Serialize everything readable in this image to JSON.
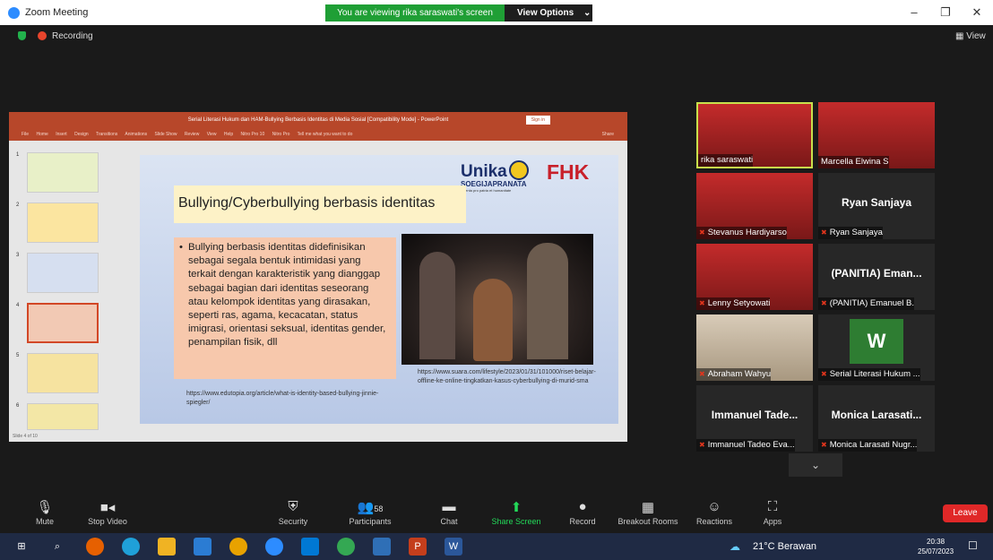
{
  "window": {
    "title": "Zoom Meeting",
    "viewing_banner": "You are viewing rika saraswati's screen",
    "view_options": "View Options"
  },
  "topbar": {
    "recording": "Recording",
    "view_label": "View"
  },
  "ppt": {
    "title": "Serial Literasi Hukum dan HAM-Bullying Berbasis Identitas di Media Sosial [Compatibility Mode] - PowerPoint",
    "signin": "Sign in",
    "menu": [
      "File",
      "Home",
      "Insert",
      "Design",
      "Transitions",
      "Animations",
      "Slide Show",
      "Review",
      "View",
      "Help",
      "Nitro Pro 10",
      "Nitro Pro",
      "Tell me what you want to do",
      "Share"
    ],
    "thumb_numbers": [
      "1",
      "2",
      "3",
      "4",
      "5",
      "6"
    ],
    "status": "Slide 4 of 10",
    "slide": {
      "logo_unika": "Unika",
      "logo_sub": "SOEGIJAPRANATA",
      "logo_tag": "Talenta pro patria et humanitate",
      "logo_fhk": "FHK",
      "heading": "Bullying/Cyberbullying berbasis identitas",
      "bullet": "•",
      "body": "Bullying berbasis identitas didefinisikan sebagai segala bentuk intimidasi yang terkait dengan karakteristik yang dianggap sebagai bagian dari identitas seseorang atau kelompok identitas yang dirasakan, seperti ras, agama, kecacatan, status imigrasi, orientasi seksual, identitas gender, penampilan fisik, dll",
      "url_photo": "https://www.suara.com/lifestyle/2023/01/31/101000/riset-belajar-offline-ke-online-tingkatkan-kasus-cyberbullying-di-murid-sma",
      "url_source": "https://www.edutopia.org/article/what-is-identity-based-bullying-jinnie-spiegler/"
    }
  },
  "participants": [
    {
      "name": "rika saraswati",
      "type": "video"
    },
    {
      "name": "Marcella Elwina S",
      "type": "video"
    },
    {
      "name": "Stevanus Hardiyarso",
      "type": "video"
    },
    {
      "name": "Ryan Sanjaya",
      "type": "name",
      "display": "Ryan Sanjaya"
    },
    {
      "name": "Lenny Setyowati",
      "type": "video"
    },
    {
      "name": "(PANITIA) Emanuel B.",
      "type": "name",
      "display": "(PANITIA) Eman..."
    },
    {
      "name": "Abraham Wahyu",
      "type": "video"
    },
    {
      "name": "Serial Literasi Hukum ...",
      "type": "avatar",
      "display": "W"
    },
    {
      "name": "Immanuel Tadeo Eva...",
      "type": "name",
      "display": "Immanuel Tade..."
    },
    {
      "name": "Monica Larasati Nugr...",
      "type": "name",
      "display": "Monica Larasati..."
    }
  ],
  "toolbar": {
    "mute": "Mute",
    "stop_video": "Stop Video",
    "security": "Security",
    "participants": "Participants",
    "participant_count": "58",
    "chat": "Chat",
    "share_screen": "Share Screen",
    "record": "Record",
    "breakout": "Breakout Rooms",
    "reactions": "Reactions",
    "apps": "Apps",
    "leave": "Leave"
  },
  "taskbar": {
    "weather": "21°C  Berawan",
    "time": "20:38",
    "date": "25/07/2023"
  },
  "colors": {
    "zoom_blue": "#2d8cff",
    "leave_red": "#e02828",
    "share_green": "#23d959",
    "ppt_red": "#b7472a"
  }
}
